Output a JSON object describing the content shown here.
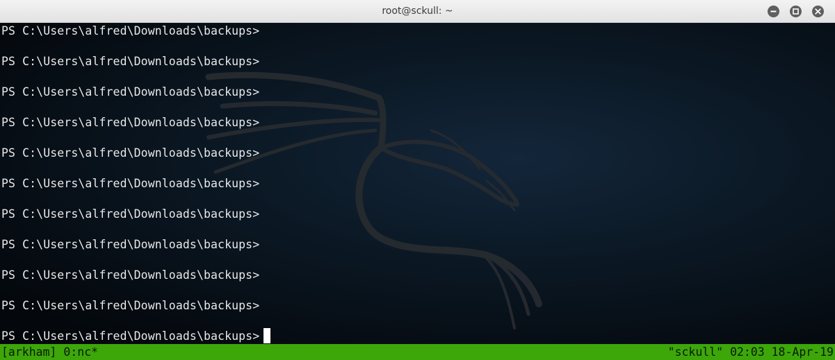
{
  "window": {
    "title": "root@sckull: ~",
    "buttons": [
      "minimize-icon",
      "maximize-icon",
      "close-icon"
    ]
  },
  "terminal": {
    "lines": [
      "PS C:\\Users\\alfred\\Downloads\\backups>",
      "PS C:\\Users\\alfred\\Downloads\\backups>",
      "PS C:\\Users\\alfred\\Downloads\\backups>",
      "PS C:\\Users\\alfred\\Downloads\\backups>",
      "PS C:\\Users\\alfred\\Downloads\\backups>",
      "PS C:\\Users\\alfred\\Downloads\\backups>",
      "PS C:\\Users\\alfred\\Downloads\\backups>",
      "PS C:\\Users\\alfred\\Downloads\\backups>",
      "PS C:\\Users\\alfred\\Downloads\\backups>",
      "PS C:\\Users\\alfred\\Downloads\\backups>",
      "PS C:\\Users\\alfred\\Downloads\\backups>"
    ],
    "background_logo": "kali-dragon-icon"
  },
  "statusbar": {
    "left": "[arkham] 0:nc*",
    "right": "\"sckull\" 02:03 18-Apr-19"
  },
  "colors": {
    "titlebar": "#e8e8e8",
    "terminal_bg": "#0b1824",
    "terminal_text": "#e9e9e9",
    "statusbar_bg": "#3da70a",
    "statusbar_text": "#0a1a02"
  }
}
